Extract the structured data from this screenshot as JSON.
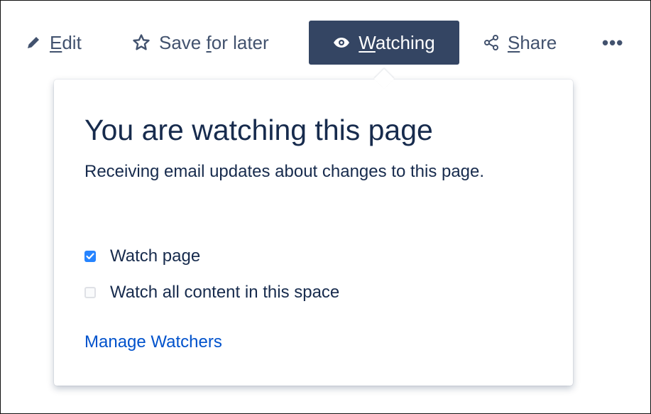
{
  "toolbar": {
    "edit": {
      "mnemonic": "E",
      "rest": "dit"
    },
    "save": {
      "pre": "Save ",
      "mnemonic": "f",
      "rest": "or later"
    },
    "watching": {
      "mnemonic": "W",
      "rest": "atching"
    },
    "share": {
      "mnemonic": "S",
      "rest": "hare"
    },
    "more": "•••"
  },
  "popup": {
    "title": "You are watching this page",
    "description": "Receiving email updates about changes to this page.",
    "options": [
      {
        "label": "Watch page",
        "checked": true
      },
      {
        "label": "Watch all content in this space",
        "checked": false
      }
    ],
    "manage_link": "Manage Watchers"
  },
  "colors": {
    "primary_button": "#344563",
    "checkbox_checked": "#2684ff",
    "link": "#0052cc",
    "text": "#172b4d"
  },
  "icons": {
    "edit": "pencil-icon",
    "save": "star-icon",
    "watching": "eye-icon",
    "share": "share-icon",
    "more": "more-icon"
  }
}
